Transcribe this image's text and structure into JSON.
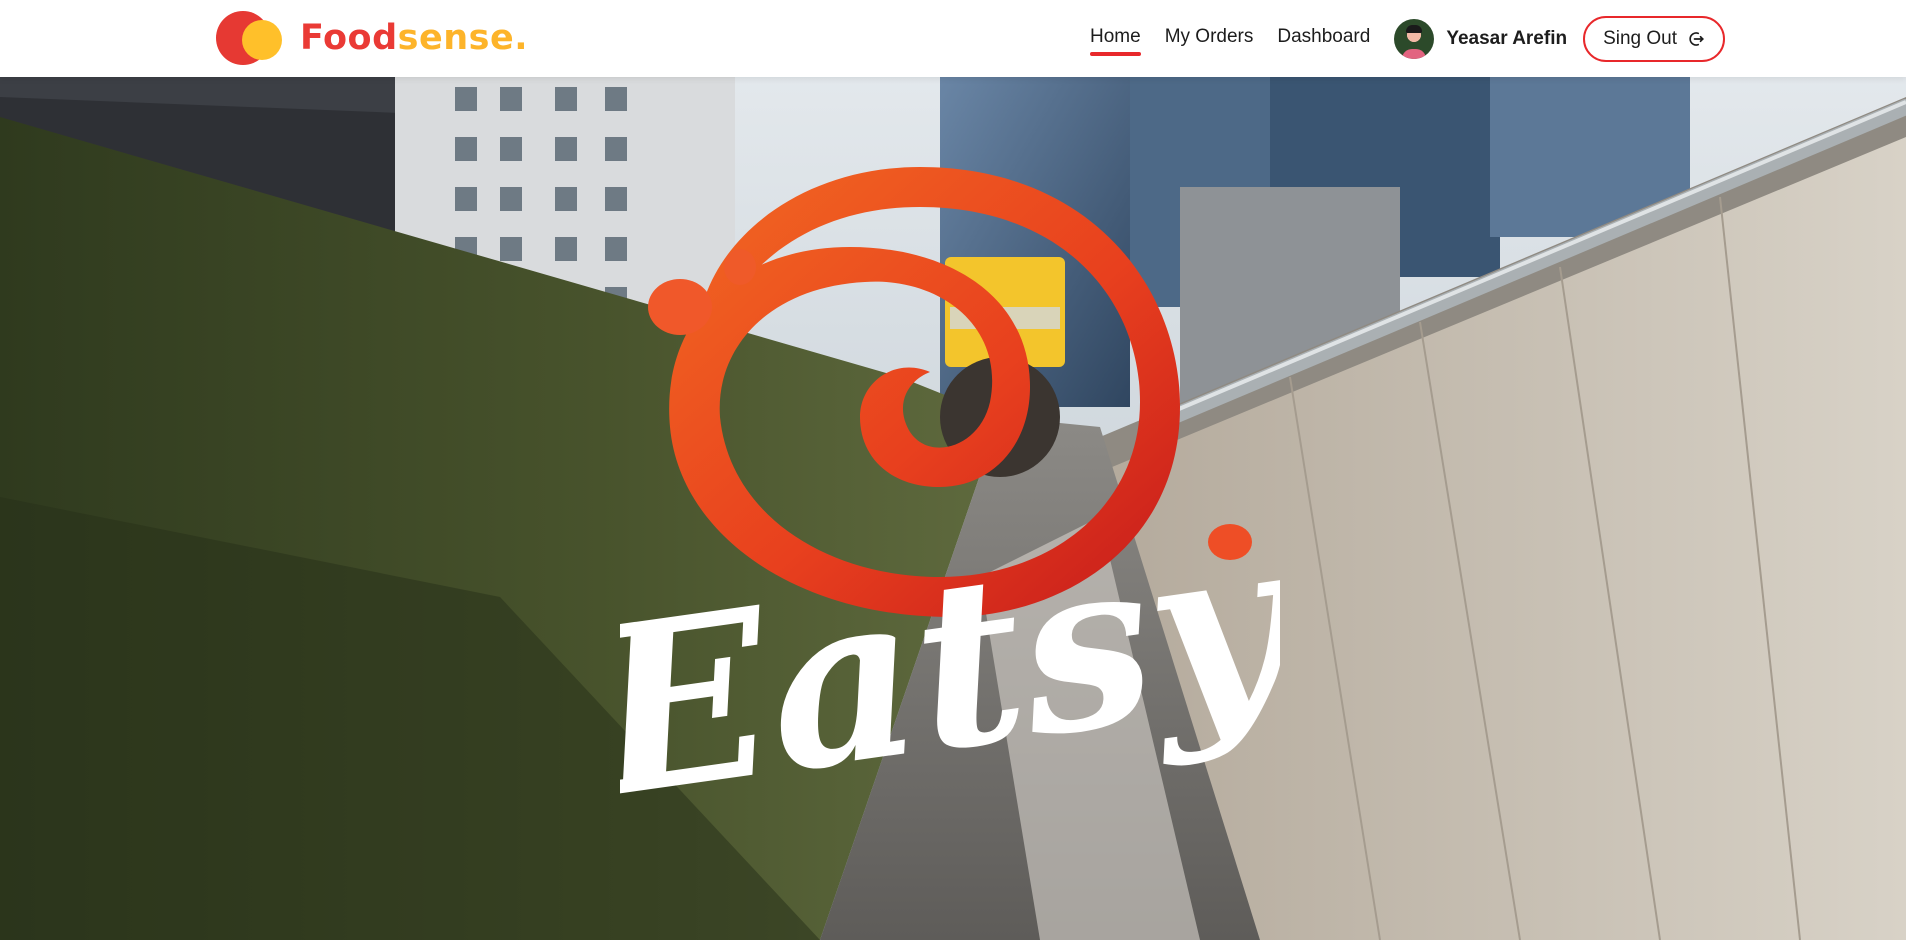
{
  "brand": {
    "name_part_1": "Food",
    "name_part_2": "sense.",
    "logo_icon": "two-circles-logo-icon",
    "colors": {
      "red": "#ea3a35",
      "yellow": "#fdb42a"
    }
  },
  "nav": {
    "links": [
      {
        "label": "Home",
        "active": true
      },
      {
        "label": "My Orders",
        "active": false
      },
      {
        "label": "Dashboard",
        "active": false
      }
    ],
    "accent_color": "#e8282b"
  },
  "user": {
    "name": "Yeasar Arefin",
    "avatar_icon": "user-avatar"
  },
  "signout": {
    "label": "Sing Out",
    "icon": "logout-icon"
  },
  "hero": {
    "logo_text": "Eatsy",
    "logo_icon": "swirl-logo-icon",
    "background": "city-alley-delivery-photo"
  }
}
